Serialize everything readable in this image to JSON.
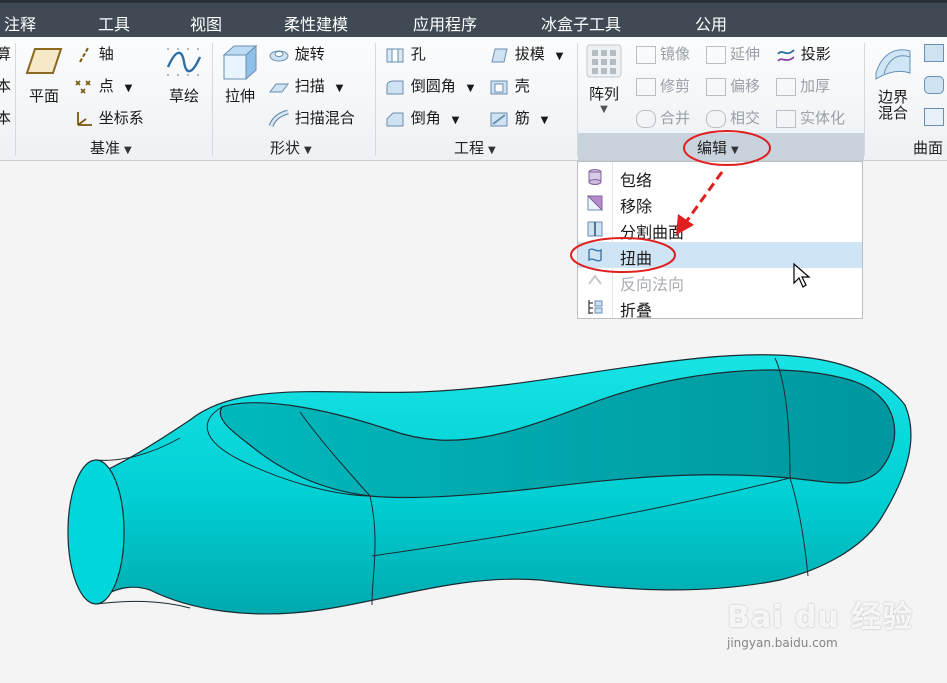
{
  "menubar": {
    "items": [
      "注释",
      "工具",
      "视图",
      "柔性建模",
      "应用程序",
      "冰盒子工具",
      "公用"
    ],
    "left_fragments": [
      "算",
      "本",
      "本"
    ]
  },
  "ribbon": {
    "datum": {
      "plane": "平面",
      "axis": "轴",
      "point": "点",
      "csys": "坐标系",
      "sketch": "草绘",
      "group": "基准"
    },
    "shapes": {
      "extrude": "拉伸",
      "revolve": "旋转",
      "sweep": "扫描",
      "swept_blend": "扫描混合",
      "group": "形状"
    },
    "engineering": {
      "hole": "孔",
      "round": "倒圆角",
      "chamfer": "倒角",
      "draft": "拔模",
      "shell": "壳",
      "rib": "筋",
      "group": "工程"
    },
    "editing": {
      "pattern": "阵列",
      "mirror": "镜像",
      "trim": "修剪",
      "merge": "合并",
      "extend": "延伸",
      "offset": "偏移",
      "intersect": "相交",
      "project": "投影",
      "thicken": "加厚",
      "solidify": "实体化",
      "group": "编辑"
    },
    "surfaces": {
      "boundary_blend_1": "边界",
      "boundary_blend_2": "混合",
      "group": "曲面"
    }
  },
  "dropdown": {
    "items": [
      {
        "label": "包络",
        "enabled": true
      },
      {
        "label": "移除",
        "enabled": true
      },
      {
        "label": "分割曲面",
        "enabled": true
      },
      {
        "label": "扭曲",
        "enabled": true,
        "highlighted": true
      },
      {
        "label": "反向法向",
        "enabled": false
      },
      {
        "label": "折叠",
        "enabled": true
      }
    ]
  },
  "colors": {
    "model": "#00d2d6",
    "annotation": "#e0201f",
    "highlight": "#cfe4f4"
  },
  "watermark": {
    "brand": "Bai du 经验",
    "url": "jingyan.baidu.com"
  }
}
